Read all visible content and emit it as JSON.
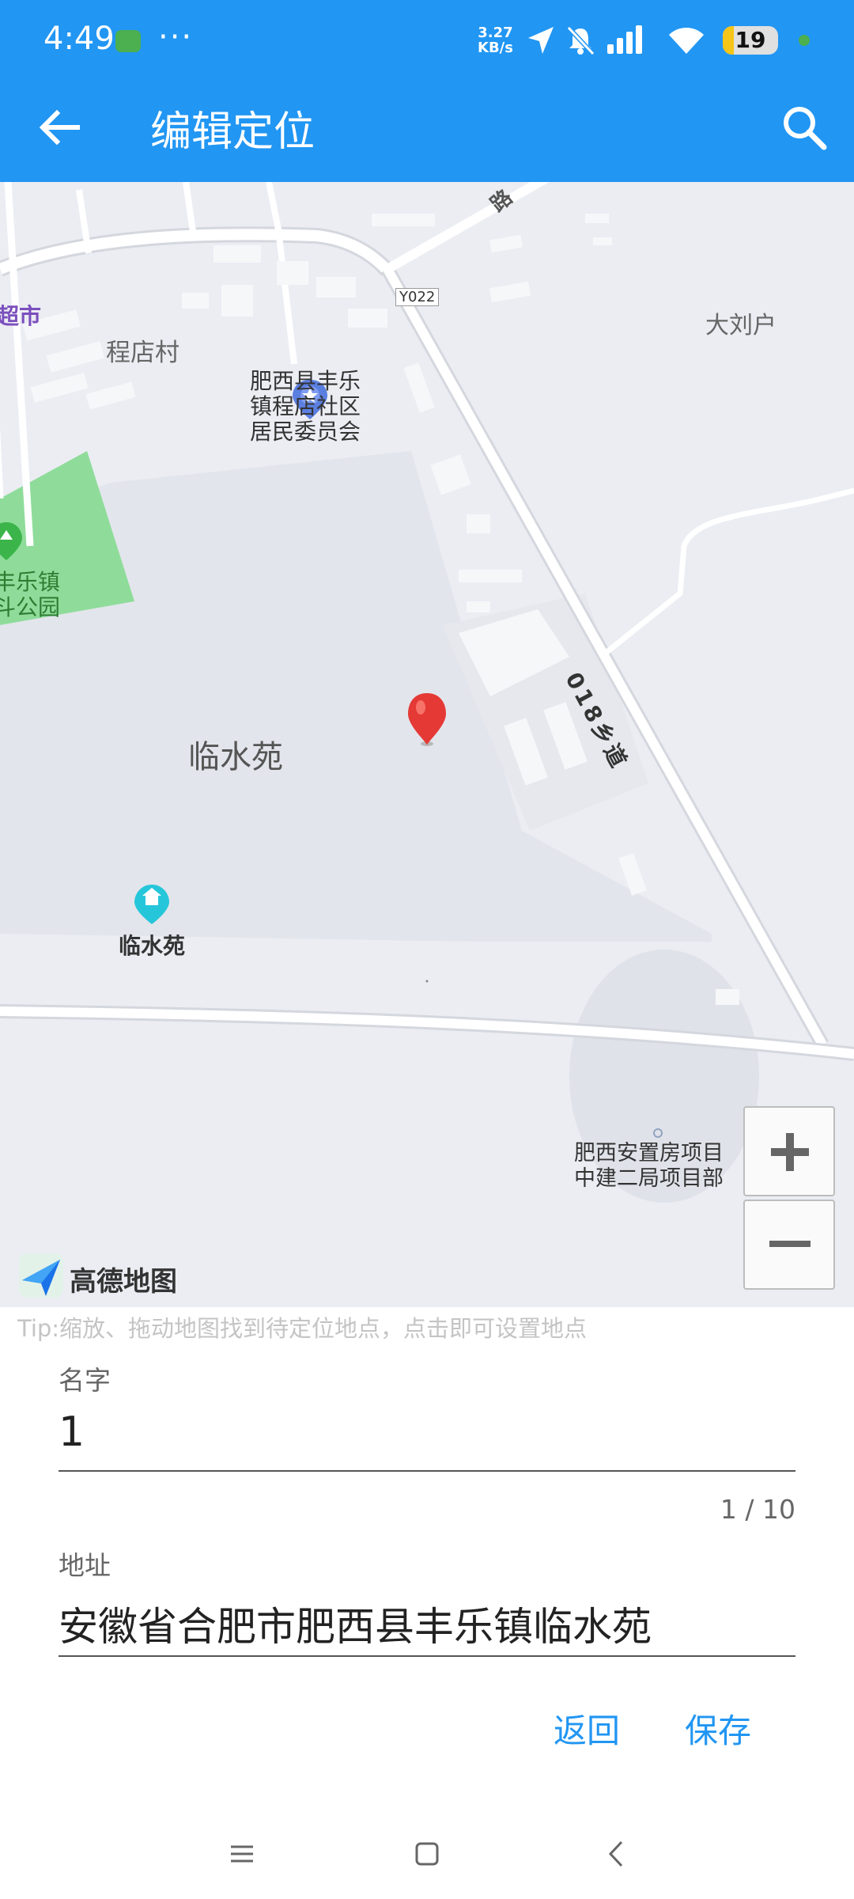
{
  "status_bar": {
    "time": "4:49",
    "dots": "···",
    "network_speed_value": "3.27",
    "network_speed_unit": "KB/s",
    "battery": "19",
    "icons": [
      "app-notification-icon",
      "location-arrow-icon",
      "bell-muted-icon",
      "signal-icon",
      "wifi-icon",
      "battery-icon"
    ]
  },
  "app_bar": {
    "title": "编辑定位",
    "back_icon": "arrow-left-icon",
    "search_icon": "search-icon"
  },
  "map": {
    "labels": {
      "supermarket": "超市",
      "village": "程店村",
      "road_y022": "Y022",
      "committee": "肥西县丰乐\n镇程店社区\n居民委员会",
      "dalihu": "大刘户",
      "park": "丰乐镇\n斗公园",
      "area": "临水苑",
      "poi": "临水苑",
      "road_018": "018乡道",
      "road_top": "路",
      "project": "肥西安置房项目\n中建二局项目部"
    },
    "logo_text": "高德地图",
    "zoom_in_icon": "plus-icon",
    "zoom_out_icon": "minus-icon",
    "colors": {
      "background": "#ebedf3",
      "road": "#ffffff",
      "park": "#8fdc9a",
      "marker": "#e53935"
    }
  },
  "tip": "Tip:缩放、拖动地图找到待定位地点，点击即可设置地点",
  "form": {
    "name_label": "名字",
    "name_value": "1",
    "name_counter": "1 / 10",
    "address_label": "地址",
    "address_value": "安徽省合肥市肥西县丰乐镇临水苑"
  },
  "buttons": {
    "back": "返回",
    "save": "保存"
  },
  "nav_bar": {
    "icons": [
      "menu-icon",
      "home-icon",
      "back-icon"
    ]
  }
}
